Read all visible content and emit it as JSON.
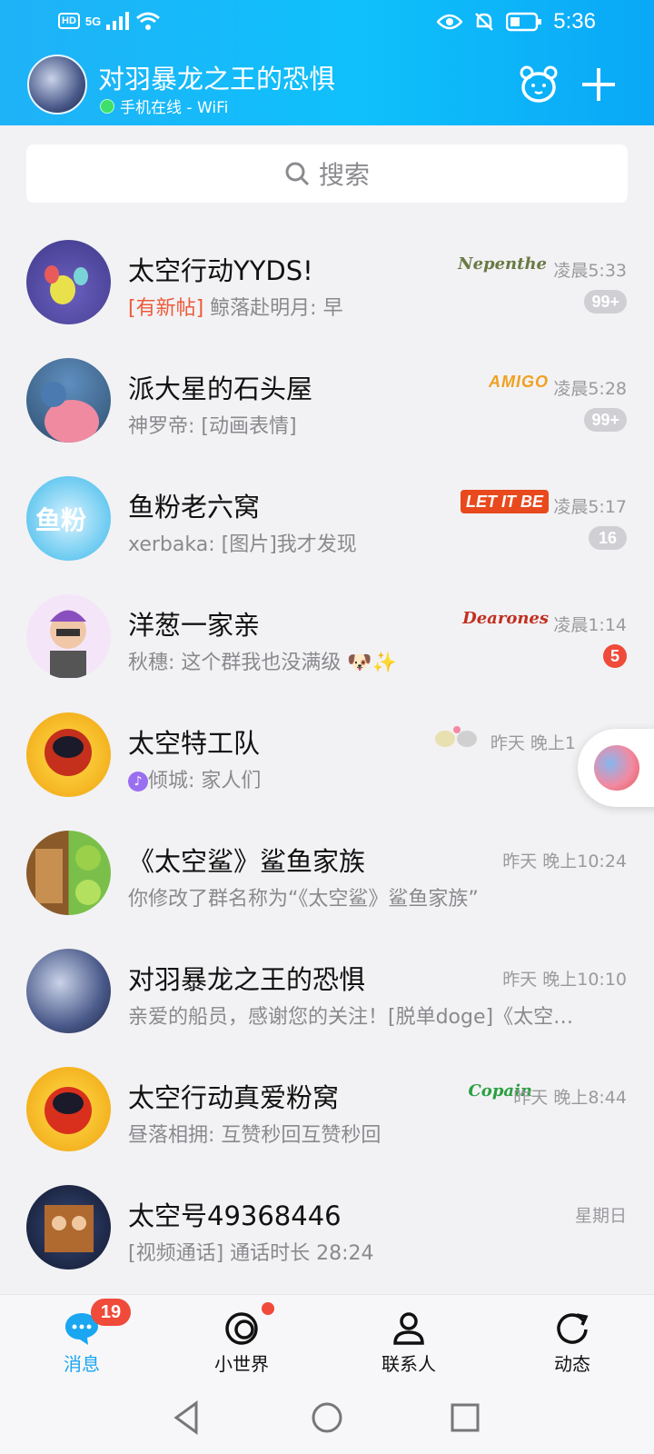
{
  "status_bar": {
    "network": "HD",
    "signal": "5G",
    "time": "5:36"
  },
  "header": {
    "title": "对羽暴龙之王的恐惧",
    "online_status": "手机在线 - WiFi"
  },
  "search": {
    "placeholder": "搜索"
  },
  "chats": [
    {
      "name": "太空行动YYDS!",
      "prefix": "[有新帖]",
      "message": "鲸落赴明月: 早",
      "tag": "Nepenthe",
      "time": "凌晨5:33",
      "badge": "99+"
    },
    {
      "name": "派大星的石头屋",
      "message": "神罗帝: [动画表情]",
      "tag": "AMIGO",
      "time": "凌晨5:28",
      "badge": "99+"
    },
    {
      "name": "鱼粉老六窝",
      "message": "xerbaka: [图片]我才发现",
      "tag": "LET IT BE",
      "time": "凌晨5:17",
      "badge": "16"
    },
    {
      "name": "洋葱一家亲",
      "message": "秋穗: 这个群我也没满级",
      "tag": "Dearones",
      "time": "凌晨1:14",
      "badge": "5"
    },
    {
      "name": "太空特工队",
      "message": "倾城: 家人们",
      "time": "昨天 晚上1"
    },
    {
      "name": "《太空鲨》鲨鱼家族",
      "message": "你修改了群名称为“《太空鲨》鲨鱼家族”",
      "time": "昨天 晚上10:24"
    },
    {
      "name": "对羽暴龙之王的恐惧",
      "message": "亲爱的船员，感谢您的关注！[脱单doge]《太空…",
      "time": "昨天 晚上10:10"
    },
    {
      "name": "太空行动真爱粉窝",
      "message": "昼落相拥: 互赞秒回互赞秒回",
      "tag": "Copain",
      "time": "昨天 晚上8:44"
    },
    {
      "name": "太空号49368446",
      "message": "[视频通话] 通话时长 28:24",
      "time": "星期日"
    }
  ],
  "tabs": [
    {
      "label": "消息",
      "badge": "19"
    },
    {
      "label": "小世界"
    },
    {
      "label": "联系人"
    },
    {
      "label": "动态"
    }
  ],
  "colors": {
    "accent": "#1aa6f0",
    "badge_red": "#f04a3a",
    "new_post": "#ee5a3a"
  }
}
